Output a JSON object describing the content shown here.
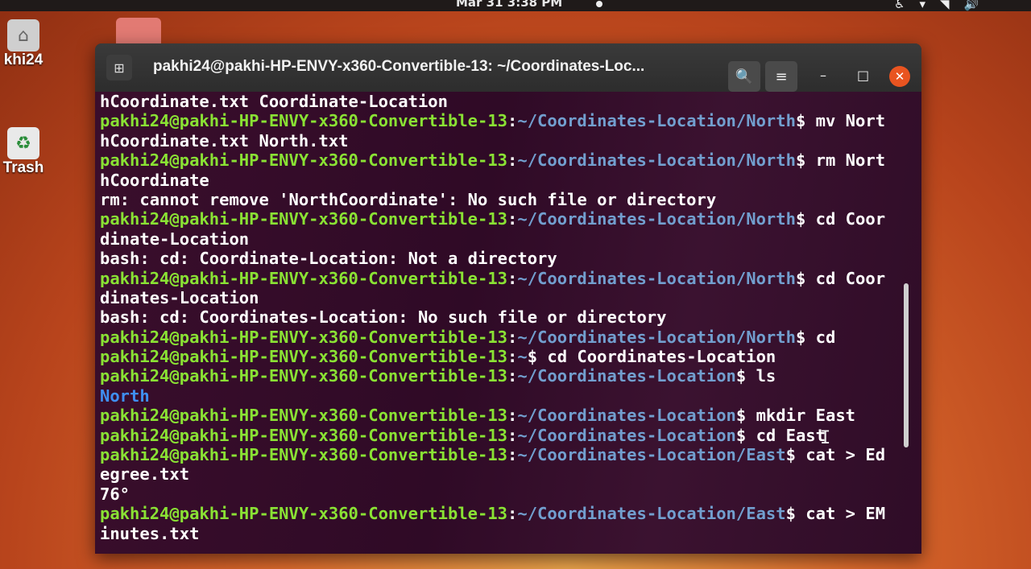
{
  "topbar": {
    "clock": "Mar 31  3:38 PM",
    "tray_icons": [
      "accessibility-icon",
      "chevron-down-icon",
      "wifi-icon",
      "volume-icon"
    ]
  },
  "desktop": {
    "home_label": "khi24",
    "trash_label": "Trash"
  },
  "window": {
    "title": "pakhi24@pakhi-HP-ENVY-x360-Convertible-13: ~/Coordinates-Loc...",
    "buttons": {
      "new_tab_icon": "new-tab-icon",
      "search_icon": "search-icon",
      "menu_icon": "hamburger-menu-icon",
      "minimize_glyph": "–",
      "maximize_glyph": "□",
      "close_glyph": "✕"
    }
  },
  "terminal": {
    "lines": [
      {
        "text": "hCoordinate.txt Coordinate-Location"
      },
      {
        "user": "pakhi24@pakhi-HP-ENVY-x360-Convertible-13",
        "path": "~/Coordinates-Location/North",
        "cmd": "$ mv Nort"
      },
      {
        "text": "hCoordinate.txt North.txt"
      },
      {
        "user": "pakhi24@pakhi-HP-ENVY-x360-Convertible-13",
        "path": "~/Coordinates-Location/North",
        "cmd": "$ rm Nort"
      },
      {
        "text": "hCoordinate"
      },
      {
        "text": "rm: cannot remove 'NorthCoordinate': No such file or directory"
      },
      {
        "user": "pakhi24@pakhi-HP-ENVY-x360-Convertible-13",
        "path": "~/Coordinates-Location/North",
        "cmd": "$ cd Coor"
      },
      {
        "text": "dinate-Location"
      },
      {
        "text": "bash: cd: Coordinate-Location: Not a directory"
      },
      {
        "user": "pakhi24@pakhi-HP-ENVY-x360-Convertible-13",
        "path": "~/Coordinates-Location/North",
        "cmd": "$ cd Coor"
      },
      {
        "text": "dinates-Location"
      },
      {
        "text": "bash: cd: Coordinates-Location: No such file or directory"
      },
      {
        "user": "pakhi24@pakhi-HP-ENVY-x360-Convertible-13",
        "path": "~/Coordinates-Location/North",
        "cmd": "$ cd"
      },
      {
        "user": "pakhi24@pakhi-HP-ENVY-x360-Convertible-13",
        "path": "~",
        "cmd": "$ cd Coordinates-Location"
      },
      {
        "user": "pakhi24@pakhi-HP-ENVY-x360-Convertible-13",
        "path": "~/Coordinates-Location",
        "cmd": "$ ls"
      },
      {
        "dir": "North"
      },
      {
        "user": "pakhi24@pakhi-HP-ENVY-x360-Convertible-13",
        "path": "~/Coordinates-Location",
        "cmd": "$ mkdir East"
      },
      {
        "user": "pakhi24@pakhi-HP-ENVY-x360-Convertible-13",
        "path": "~/Coordinates-Location",
        "cmd": "$ cd East"
      },
      {
        "user": "pakhi24@pakhi-HP-ENVY-x360-Convertible-13",
        "path": "~/Coordinates-Location/East",
        "cmd": "$ cat > Ed"
      },
      {
        "text": "egree.txt"
      },
      {
        "text": "76°"
      },
      {
        "user": "pakhi24@pakhi-HP-ENVY-x360-Convertible-13",
        "path": "~/Coordinates-Location/East",
        "cmd": "$ cat > EM"
      },
      {
        "text": "inutes.txt"
      }
    ]
  },
  "colors": {
    "terminal_bg": "#300a24",
    "prompt_user": "#8ae234",
    "prompt_path": "#729fcf",
    "dir_listing": "#3f8ff2",
    "close_button": "#e95420"
  }
}
